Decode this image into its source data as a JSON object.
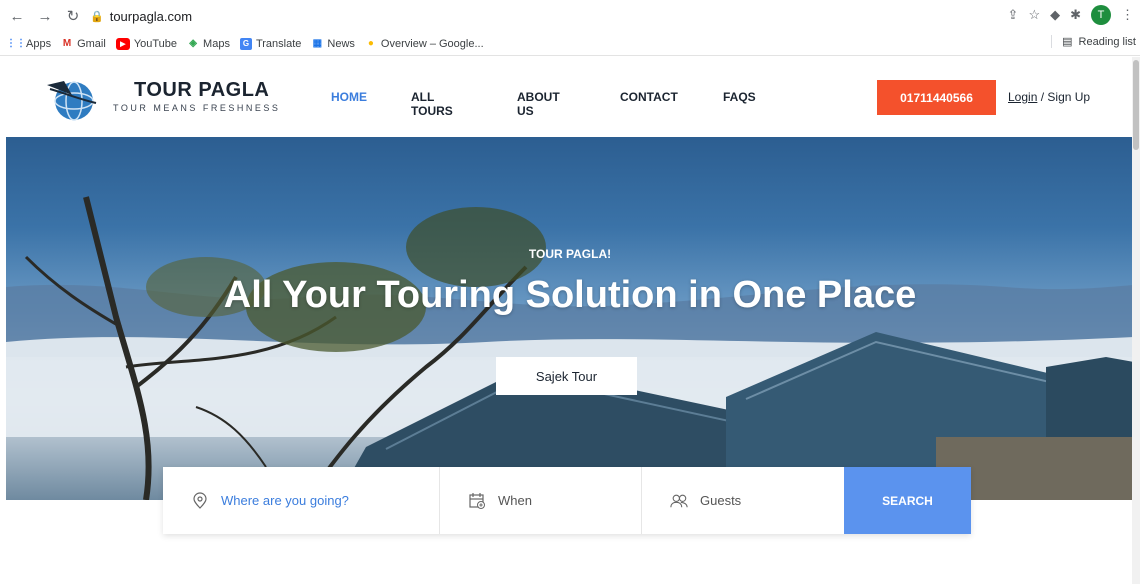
{
  "browser": {
    "url": "tourpagla.com",
    "profile_initial": "T",
    "bookmarks": [
      {
        "label": "Apps",
        "icon": "apps-grid-icon"
      },
      {
        "label": "Gmail",
        "icon": "gmail-icon"
      },
      {
        "label": "YouTube",
        "icon": "youtube-icon"
      },
      {
        "label": "Maps",
        "icon": "maps-icon"
      },
      {
        "label": "Translate",
        "icon": "translate-icon"
      },
      {
        "label": "News",
        "icon": "news-icon"
      },
      {
        "label": "Overview – Google...",
        "icon": "location-pin-icon"
      }
    ],
    "reading_list": "Reading list"
  },
  "header": {
    "brand_title": "TOUR PAGLA",
    "brand_tagline": "TOUR MEANS FRESHNESS",
    "nav": [
      "HOME",
      "ALL TOURS",
      "ABOUT US",
      "CONTACT",
      "FAQS"
    ],
    "active_nav": "HOME",
    "phone": "01711440566",
    "login": "Login",
    "separator": "/",
    "signup": "Sign Up"
  },
  "hero": {
    "kicker": "TOUR PAGLA!",
    "title": "All Your Touring Solution in One Place",
    "cta": "Sajek Tour"
  },
  "search": {
    "where": "Where are you going?",
    "when": "When",
    "guests": "Guests",
    "button": "SEARCH"
  },
  "colors": {
    "accent": "#3b7ddd",
    "phone_button": "#f4512c",
    "search_button": "#5b93ee"
  }
}
